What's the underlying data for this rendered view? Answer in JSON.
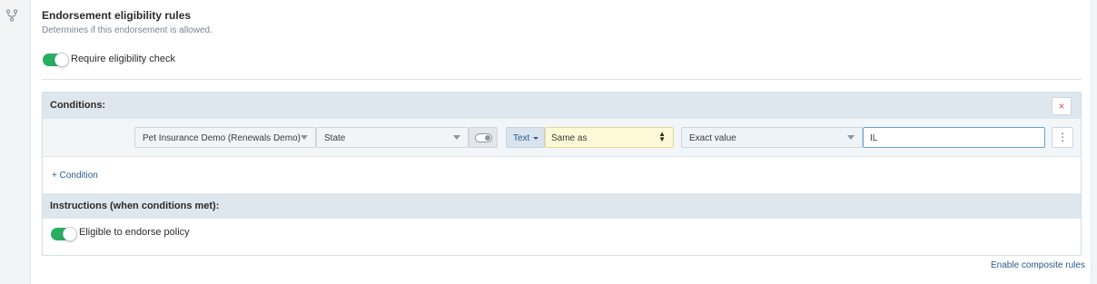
{
  "rail": {
    "icon": "branch-icon"
  },
  "section": {
    "title": "Endorsement eligibility rules",
    "subtitle": "Determines if this endorsement is allowed."
  },
  "require_check": {
    "label": "Require eligibility check",
    "on": true
  },
  "conditions": {
    "title": "Conditions:",
    "close_label": "×",
    "rows": [
      {
        "source": "Pet Insurance Demo (Renewals Demo)",
        "field": "State",
        "type": "Text",
        "operator": "Same as",
        "value_mode": "Exact value",
        "value": "IL"
      }
    ],
    "add_label": "+ Condition"
  },
  "instructions": {
    "title": "Instructions (when conditions met):",
    "eligible_label": "Eligible to endorse policy",
    "eligible_on": true
  },
  "footer": {
    "composite_label": "Enable composite rules"
  },
  "colors": {
    "toggle_on": "#27ae60",
    "link": "#2b5b8c",
    "header_bg": "#dfe7ee",
    "operator_bg": "#fdf8d5"
  }
}
